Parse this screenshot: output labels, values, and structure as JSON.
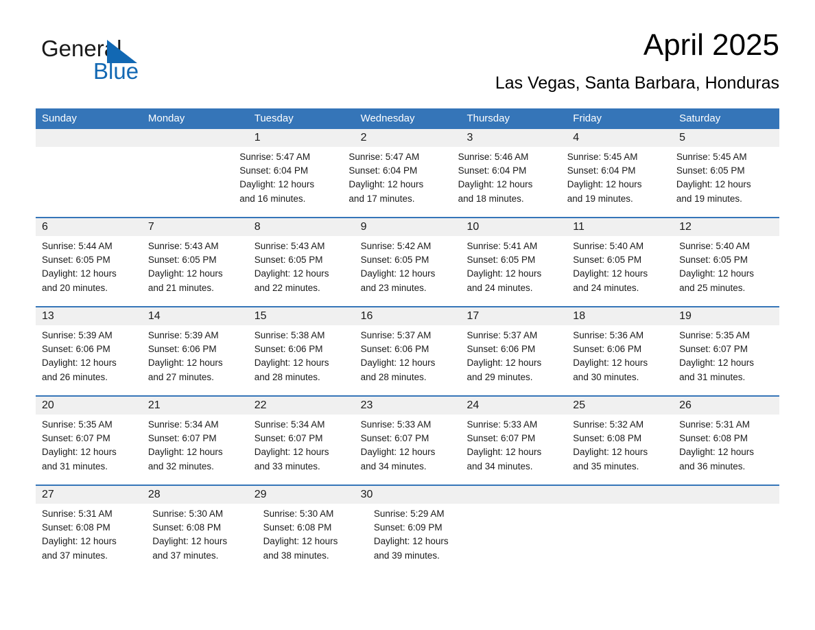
{
  "brand": {
    "word_general": "General",
    "word_blue": "Blue",
    "accent_color": "#1268b3",
    "triangle_icon": "brand-triangle-icon"
  },
  "header": {
    "title": "April 2025",
    "subtitle": "Las Vegas, Santa Barbara, Honduras"
  },
  "calendar": {
    "header_bg": "#3575b8",
    "header_text_color": "#ffffff",
    "daynum_band_bg": "#f0f0f0",
    "row_divider_color": "#3575b8",
    "weekdays": [
      "Sunday",
      "Monday",
      "Tuesday",
      "Wednesday",
      "Thursday",
      "Friday",
      "Saturday"
    ],
    "weeks": [
      {
        "days": [
          {
            "num": "",
            "lines": []
          },
          {
            "num": "",
            "lines": []
          },
          {
            "num": "1",
            "lines": [
              "Sunrise: 5:47 AM",
              "Sunset: 6:04 PM",
              "Daylight: 12 hours",
              "and 16 minutes."
            ]
          },
          {
            "num": "2",
            "lines": [
              "Sunrise: 5:47 AM",
              "Sunset: 6:04 PM",
              "Daylight: 12 hours",
              "and 17 minutes."
            ]
          },
          {
            "num": "3",
            "lines": [
              "Sunrise: 5:46 AM",
              "Sunset: 6:04 PM",
              "Daylight: 12 hours",
              "and 18 minutes."
            ]
          },
          {
            "num": "4",
            "lines": [
              "Sunrise: 5:45 AM",
              "Sunset: 6:04 PM",
              "Daylight: 12 hours",
              "and 19 minutes."
            ]
          },
          {
            "num": "5",
            "lines": [
              "Sunrise: 5:45 AM",
              "Sunset: 6:05 PM",
              "Daylight: 12 hours",
              "and 19 minutes."
            ]
          }
        ]
      },
      {
        "days": [
          {
            "num": "6",
            "lines": [
              "Sunrise: 5:44 AM",
              "Sunset: 6:05 PM",
              "Daylight: 12 hours",
              "and 20 minutes."
            ]
          },
          {
            "num": "7",
            "lines": [
              "Sunrise: 5:43 AM",
              "Sunset: 6:05 PM",
              "Daylight: 12 hours",
              "and 21 minutes."
            ]
          },
          {
            "num": "8",
            "lines": [
              "Sunrise: 5:43 AM",
              "Sunset: 6:05 PM",
              "Daylight: 12 hours",
              "and 22 minutes."
            ]
          },
          {
            "num": "9",
            "lines": [
              "Sunrise: 5:42 AM",
              "Sunset: 6:05 PM",
              "Daylight: 12 hours",
              "and 23 minutes."
            ]
          },
          {
            "num": "10",
            "lines": [
              "Sunrise: 5:41 AM",
              "Sunset: 6:05 PM",
              "Daylight: 12 hours",
              "and 24 minutes."
            ]
          },
          {
            "num": "11",
            "lines": [
              "Sunrise: 5:40 AM",
              "Sunset: 6:05 PM",
              "Daylight: 12 hours",
              "and 24 minutes."
            ]
          },
          {
            "num": "12",
            "lines": [
              "Sunrise: 5:40 AM",
              "Sunset: 6:05 PM",
              "Daylight: 12 hours",
              "and 25 minutes."
            ]
          }
        ]
      },
      {
        "days": [
          {
            "num": "13",
            "lines": [
              "Sunrise: 5:39 AM",
              "Sunset: 6:06 PM",
              "Daylight: 12 hours",
              "and 26 minutes."
            ]
          },
          {
            "num": "14",
            "lines": [
              "Sunrise: 5:39 AM",
              "Sunset: 6:06 PM",
              "Daylight: 12 hours",
              "and 27 minutes."
            ]
          },
          {
            "num": "15",
            "lines": [
              "Sunrise: 5:38 AM",
              "Sunset: 6:06 PM",
              "Daylight: 12 hours",
              "and 28 minutes."
            ]
          },
          {
            "num": "16",
            "lines": [
              "Sunrise: 5:37 AM",
              "Sunset: 6:06 PM",
              "Daylight: 12 hours",
              "and 28 minutes."
            ]
          },
          {
            "num": "17",
            "lines": [
              "Sunrise: 5:37 AM",
              "Sunset: 6:06 PM",
              "Daylight: 12 hours",
              "and 29 minutes."
            ]
          },
          {
            "num": "18",
            "lines": [
              "Sunrise: 5:36 AM",
              "Sunset: 6:06 PM",
              "Daylight: 12 hours",
              "and 30 minutes."
            ]
          },
          {
            "num": "19",
            "lines": [
              "Sunrise: 5:35 AM",
              "Sunset: 6:07 PM",
              "Daylight: 12 hours",
              "and 31 minutes."
            ]
          }
        ]
      },
      {
        "days": [
          {
            "num": "20",
            "lines": [
              "Sunrise: 5:35 AM",
              "Sunset: 6:07 PM",
              "Daylight: 12 hours",
              "and 31 minutes."
            ]
          },
          {
            "num": "21",
            "lines": [
              "Sunrise: 5:34 AM",
              "Sunset: 6:07 PM",
              "Daylight: 12 hours",
              "and 32 minutes."
            ]
          },
          {
            "num": "22",
            "lines": [
              "Sunrise: 5:34 AM",
              "Sunset: 6:07 PM",
              "Daylight: 12 hours",
              "and 33 minutes."
            ]
          },
          {
            "num": "23",
            "lines": [
              "Sunrise: 5:33 AM",
              "Sunset: 6:07 PM",
              "Daylight: 12 hours",
              "and 34 minutes."
            ]
          },
          {
            "num": "24",
            "lines": [
              "Sunrise: 5:33 AM",
              "Sunset: 6:07 PM",
              "Daylight: 12 hours",
              "and 34 minutes."
            ]
          },
          {
            "num": "25",
            "lines": [
              "Sunrise: 5:32 AM",
              "Sunset: 6:08 PM",
              "Daylight: 12 hours",
              "and 35 minutes."
            ]
          },
          {
            "num": "26",
            "lines": [
              "Sunrise: 5:31 AM",
              "Sunset: 6:08 PM",
              "Daylight: 12 hours",
              "and 36 minutes."
            ]
          }
        ]
      },
      {
        "days": [
          {
            "num": "27",
            "lines": [
              "Sunrise: 5:31 AM",
              "Sunset: 6:08 PM",
              "Daylight: 12 hours",
              "and 37 minutes."
            ]
          },
          {
            "num": "28",
            "lines": [
              "Sunrise: 5:30 AM",
              "Sunset: 6:08 PM",
              "Daylight: 12 hours",
              "and 37 minutes."
            ]
          },
          {
            "num": "29",
            "lines": [
              "Sunrise: 5:30 AM",
              "Sunset: 6:08 PM",
              "Daylight: 12 hours",
              "and 38 minutes."
            ]
          },
          {
            "num": "30",
            "lines": [
              "Sunrise: 5:29 AM",
              "Sunset: 6:09 PM",
              "Daylight: 12 hours",
              "and 39 minutes."
            ]
          },
          {
            "num": "",
            "lines": []
          },
          {
            "num": "",
            "lines": []
          },
          {
            "num": "",
            "lines": []
          }
        ]
      }
    ]
  }
}
